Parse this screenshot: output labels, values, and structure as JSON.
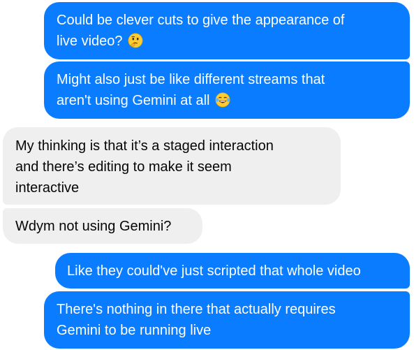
{
  "messages": [
    {
      "sender": "me",
      "line1": "Could be clever cuts to give the appearance of",
      "line2": "live video?",
      "emoji": "thinking-face-icon"
    },
    {
      "sender": "me",
      "line1": "Might also just be like different streams that",
      "line2": "aren't using Gemini at all",
      "emoji": "laughing-tears-face-icon"
    },
    {
      "sender": "them",
      "line1": "My thinking is that it’s a staged interaction",
      "line2": "and there’s editing to make it seem",
      "line3": "interactive"
    },
    {
      "sender": "them",
      "line1": "Wdym not using Gemini?"
    },
    {
      "sender": "me",
      "line1": "Like they could've just scripted that whole video"
    },
    {
      "sender": "me",
      "line1": "There's nothing in there that actually requires",
      "line2": "Gemini to be running live"
    }
  ],
  "colors": {
    "outgoing_bubble": "#0a7cff",
    "incoming_bubble": "#efefef",
    "outgoing_text": "#ffffff",
    "incoming_text": "#050505"
  }
}
